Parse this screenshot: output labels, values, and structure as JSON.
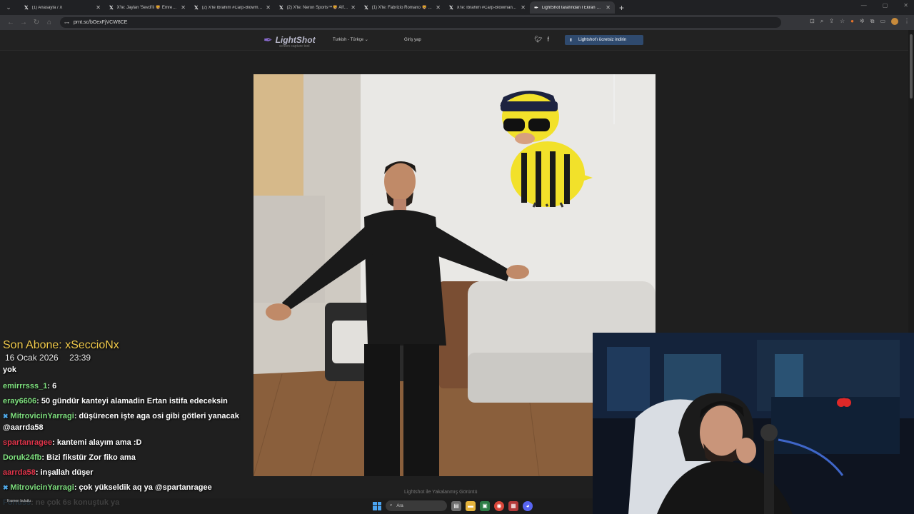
{
  "browser": {
    "tabs": [
      {
        "label": "(1) Anasayfa / X",
        "active": false
      },
      {
        "label": "X'te: Jaylan 'Sevdi'li 🦁 Emredeli...",
        "active": false
      },
      {
        "label": "(2) X'te İbrahim #Carp-Blowman...",
        "active": false
      },
      {
        "label": "(2) X'te: Neron Sports™🦁 Alfeb...",
        "active": false
      },
      {
        "label": "(1) X'te: Fabrizio Romano 🦁 ...",
        "active": false
      },
      {
        "label": "X'te: İbrahim #Carp-Blowman...",
        "active": false
      },
      {
        "label": "LightShot tarafından İ Ekran Gö...",
        "active": true
      }
    ],
    "url": "prnt.sc/bOexFjVCW8CE"
  },
  "lightshot": {
    "logo": "LightShot",
    "tagline": "screen capture tool",
    "language": "Turkish - Türkçe",
    "login": "Giriş yap",
    "download": "Lightshot'ı ücretsiz indirin",
    "caption": "Lightshot ile Yakalanmış Görüntü"
  },
  "stream_overlay": {
    "last_sub": "Son Abone: xSeccioNx",
    "date": "16 Ocak 2026",
    "time": "23:39"
  },
  "chat": [
    {
      "user": "",
      "color": "#ffffff",
      "badge": false,
      "text": "yok",
      "clip": true
    },
    {
      "user": "emirrrsss_1",
      "color": "#7ee07e",
      "badge": false,
      "text": "6"
    },
    {
      "user": "eray6606",
      "color": "#7ee07e",
      "badge": false,
      "text": "50 gündür kanteyi alamadin Ertan istifa edeceksin"
    },
    {
      "user": "MitrovicinYarragi",
      "color": "#7ee07e",
      "badge": true,
      "text": "düşürecen işte aga osi gibi götleri yanacak @aarrda58"
    },
    {
      "user": "spartanragee",
      "color": "#e0344a",
      "badge": false,
      "text": "kantemi alayım ama :D"
    },
    {
      "user": "Doruk24fb",
      "color": "#7ee07e",
      "badge": false,
      "text": "Bizi fikstür Zor fiko ama"
    },
    {
      "user": "aarrda58",
      "color": "#e0344a",
      "badge": false,
      "text": "inşallah düşer"
    },
    {
      "user": "MitrovicinYarragi",
      "color": "#7ee07e",
      "badge": true,
      "text": "çok yükseldik aq ya @spartanragee"
    },
    {
      "user": "Fonuss",
      "color": "#4fa8e8",
      "badge": false,
      "text": "ne çok 6s konuştuk ya"
    }
  ],
  "taskbar": {
    "search": "Ara",
    "weather": "Kısmen bulutlu"
  },
  "colors": {
    "accent": "#2f4a6e",
    "overlay_title": "#f0c94a",
    "page_bg": "#1f1f1f"
  }
}
